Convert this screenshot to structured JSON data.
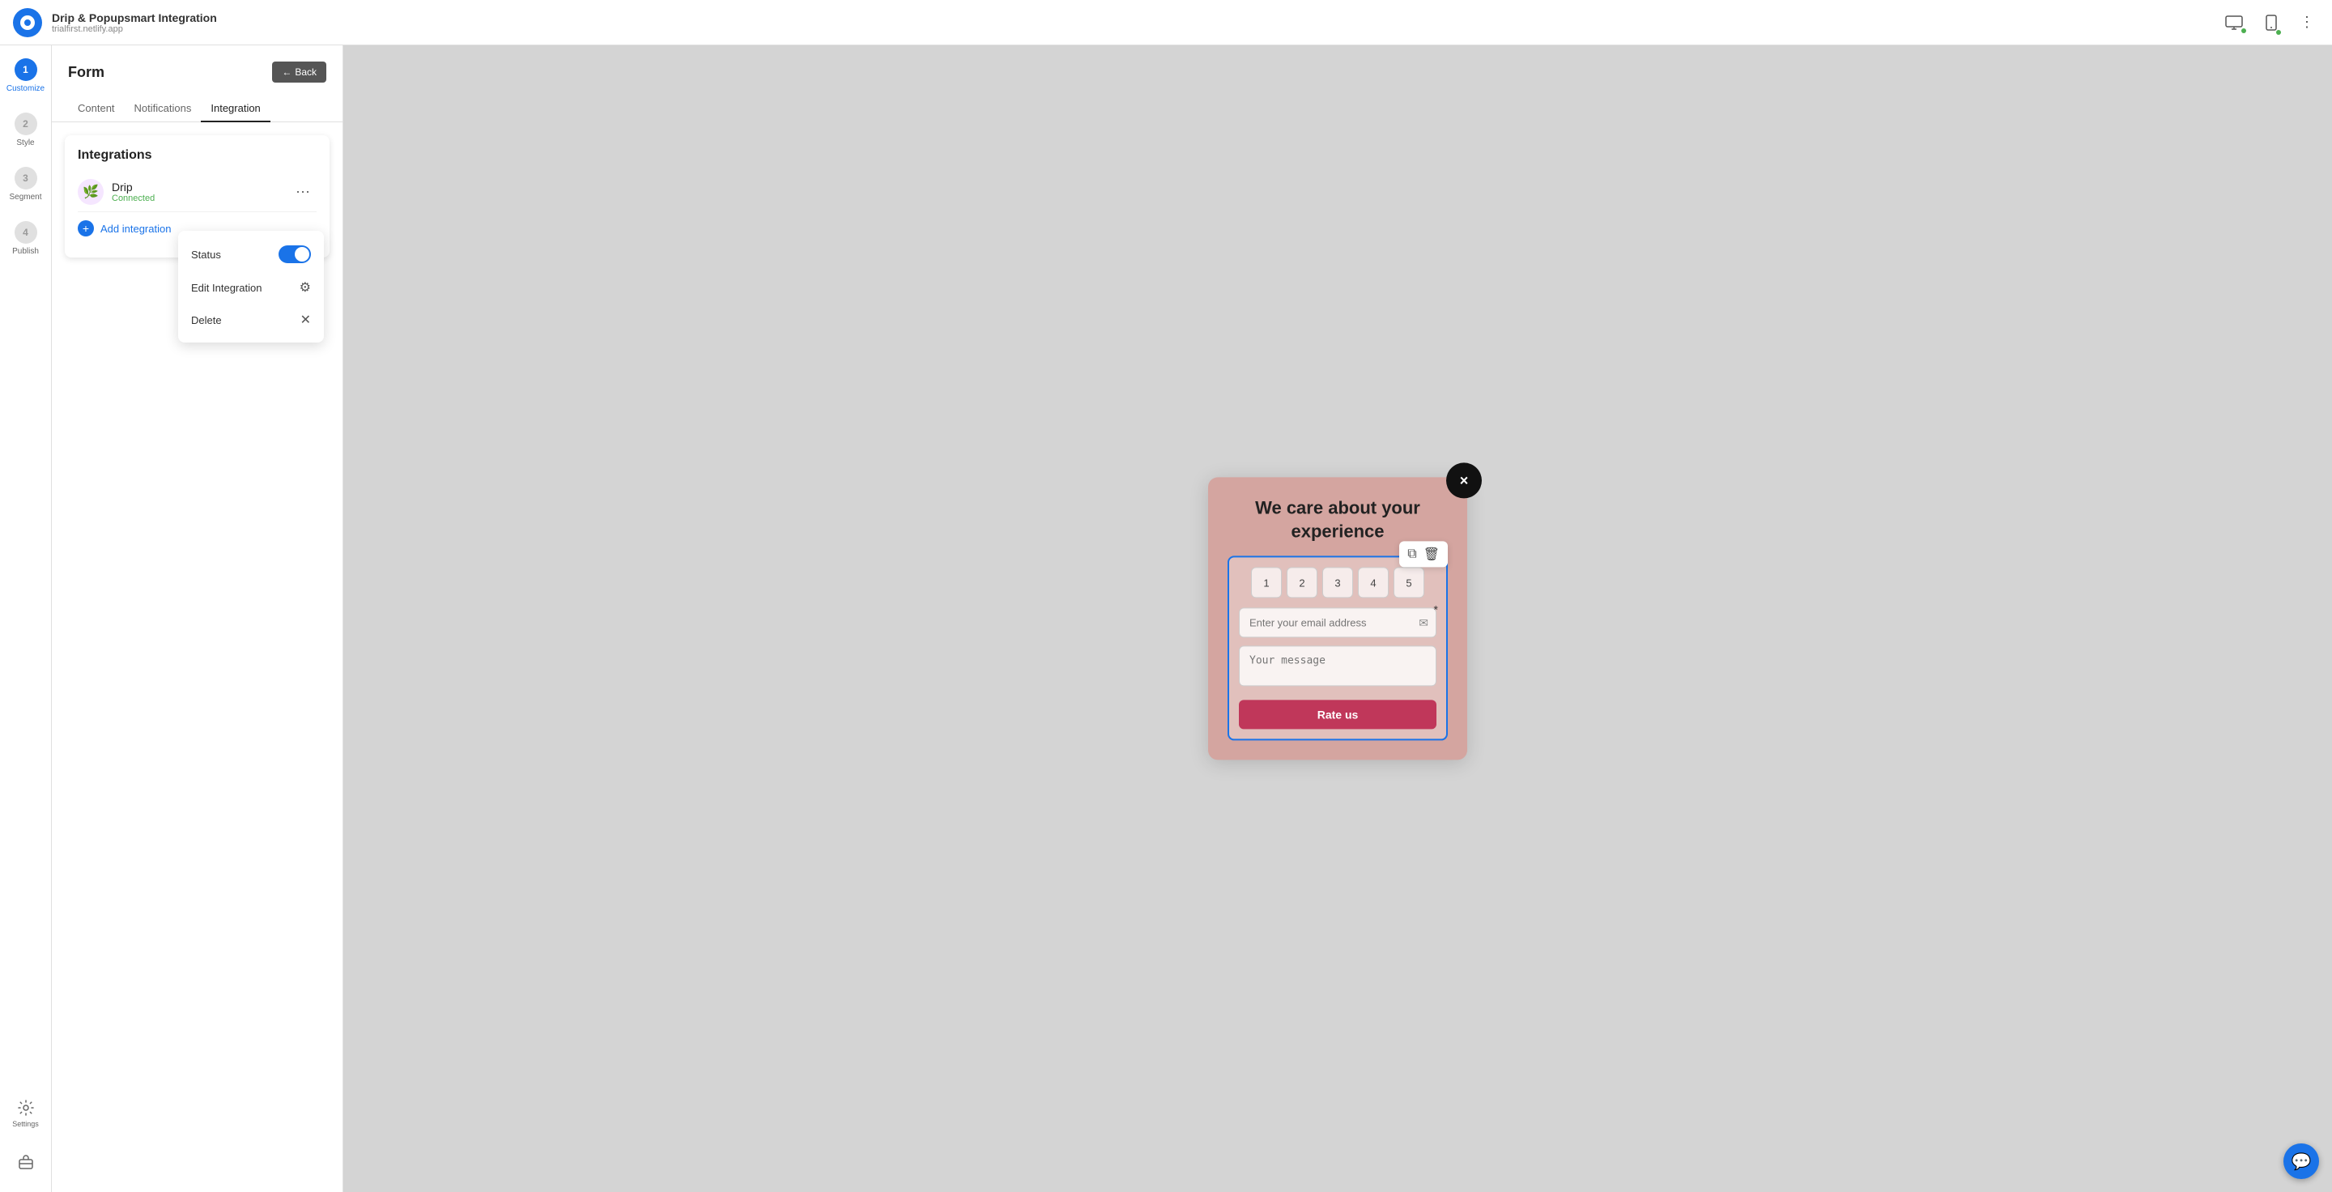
{
  "topbar": {
    "title": "Drip & Popupsmart Integration",
    "subtitle": "trialfirst.netlify.app",
    "desktop_tooltip": "Desktop",
    "mobile_tooltip": "Mobile",
    "more_label": "⋮"
  },
  "sidebar": {
    "steps": [
      {
        "number": "1",
        "label": "Customize",
        "active": true
      },
      {
        "number": "2",
        "label": "Style",
        "active": false
      },
      {
        "number": "3",
        "label": "Segment",
        "active": false
      },
      {
        "number": "4",
        "label": "Publish",
        "active": false
      }
    ],
    "settings_label": "Settings"
  },
  "panel": {
    "title": "Form",
    "back_label": "Back",
    "tabs": [
      {
        "label": "Content",
        "active": false
      },
      {
        "label": "Notifications",
        "active": false
      },
      {
        "label": "Integration",
        "active": true
      }
    ]
  },
  "integrations": {
    "title": "Integrations",
    "drip": {
      "name": "Drip",
      "status": "Connected"
    },
    "add_label": "Add integration"
  },
  "dropdown": {
    "status_label": "Status",
    "edit_label": "Edit Integration",
    "delete_label": "Delete"
  },
  "popup": {
    "title": "We care about your experience",
    "close_label": "×",
    "rating": [
      "1",
      "2",
      "3",
      "4",
      "5"
    ],
    "email_placeholder": "Enter your email address",
    "message_placeholder": "Your message",
    "submit_label": "Rate us"
  },
  "chat": {
    "icon": "💬"
  },
  "icons": {
    "back_arrow": "←",
    "copy": "⧉",
    "trash": "🗑",
    "gear": "⚙",
    "close": "✕",
    "plus": "+",
    "drip_emoji": "🌿",
    "desktop": "🖥",
    "mobile": "📱"
  }
}
